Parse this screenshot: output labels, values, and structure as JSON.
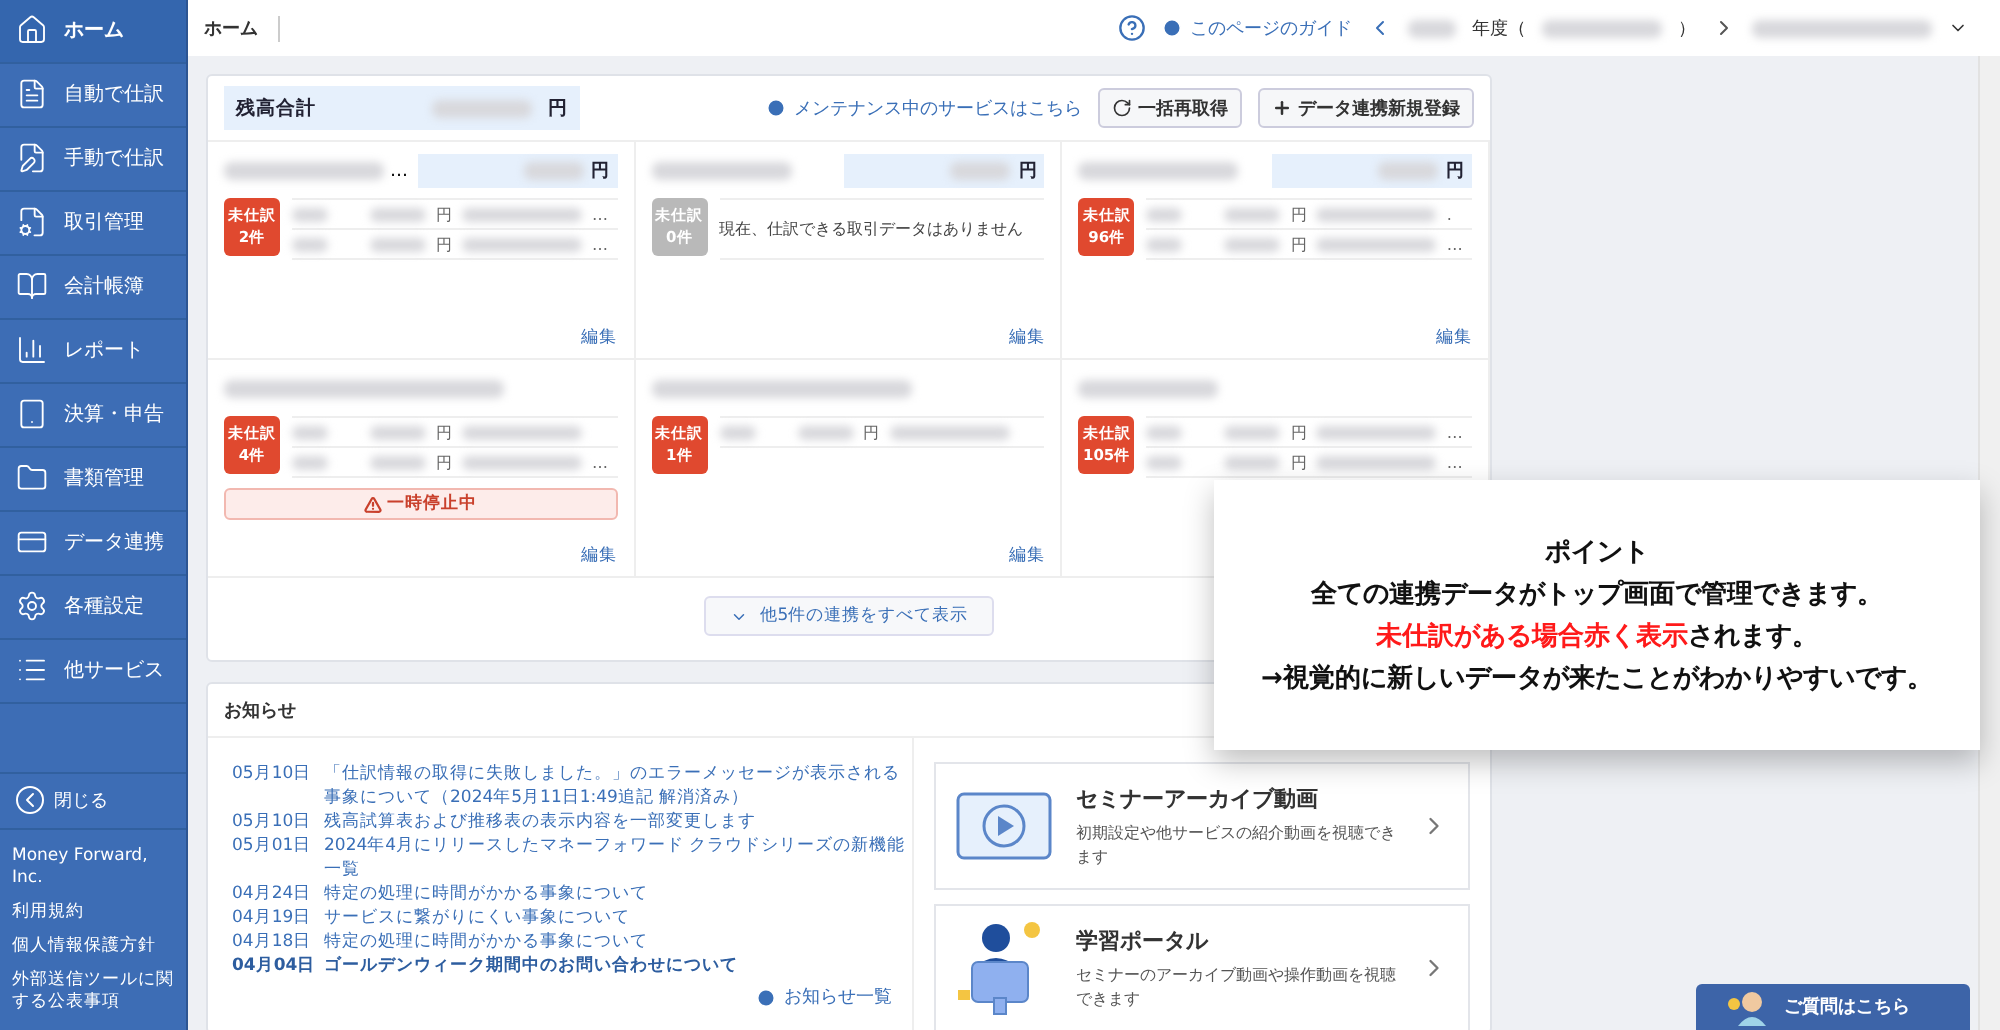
{
  "sidebar": {
    "items": [
      {
        "label": "ホーム",
        "selected": true
      },
      {
        "label": "自動で仕訳",
        "selected": false
      },
      {
        "label": "手動で仕訳",
        "selected": false
      },
      {
        "label": "取引管理",
        "selected": false
      },
      {
        "label": "会計帳簿",
        "selected": false
      },
      {
        "label": "レポート",
        "selected": false
      },
      {
        "label": "決算・申告",
        "selected": false
      },
      {
        "label": "書類管理",
        "selected": false
      },
      {
        "label": "データ連携",
        "selected": false
      },
      {
        "label": "各種設定",
        "selected": false
      },
      {
        "label": "他サービス",
        "selected": false
      }
    ],
    "close": "閉じる",
    "company": "Money Forward, Inc.",
    "links": [
      "利用規約",
      "個人情報保護方針",
      "外部送信ツールに関する公表事項"
    ]
  },
  "header": {
    "breadcrumb": "ホーム",
    "guide": "このページのガイド",
    "year_label": "年度（",
    "year_close": "）"
  },
  "balance": {
    "label": "残高合計",
    "unit": "円",
    "maintenance_link": "メンテナンス中のサービスはこちら",
    "buttons": [
      {
        "kind": "refresh",
        "label": "一括再取得"
      },
      {
        "kind": "add",
        "label": "データ連携新規登録"
      }
    ]
  },
  "accounts": [
    {
      "name_tail": "…",
      "unit": "円",
      "badge": {
        "label": "未仕訳",
        "count": "2件",
        "pending": true
      },
      "rows": [
        {
          "unit": "円",
          "tail": "…"
        },
        {
          "unit": "円",
          "tail": "…"
        }
      ],
      "edit": "編集"
    },
    {
      "unit": "円",
      "badge": {
        "label": "未仕訳",
        "count": "0件",
        "pending": false
      },
      "message": "現在、仕訳できる取引データはありません",
      "edit": "編集"
    },
    {
      "unit": "円",
      "badge": {
        "label": "未仕訳",
        "count": "96件",
        "pending": true
      },
      "rows": [
        {
          "unit": "円",
          "tail": "."
        },
        {
          "unit": "円",
          "tail": "…"
        }
      ],
      "edit": "編集"
    },
    {
      "badge": {
        "label": "未仕訳",
        "count": "4件",
        "pending": true
      },
      "rows": [
        {
          "unit": "円"
        },
        {
          "unit": "円",
          "tail": "…"
        }
      ],
      "warning": "一時停止中",
      "edit": "編集"
    },
    {
      "badge": {
        "label": "未仕訳",
        "count": "1件",
        "pending": true
      },
      "rows": [
        {
          "unit": "円"
        }
      ],
      "edit": "編集"
    },
    {
      "badge": {
        "label": "未仕訳",
        "count": "105件",
        "pending": true
      },
      "rows": [
        {
          "unit": "円",
          "tail": "…"
        },
        {
          "unit": "円",
          "tail": "…"
        }
      ]
    }
  ],
  "show_more": "他5件の連携をすべて表示",
  "news": {
    "title": "お知らせ",
    "items": [
      {
        "date": "05月10日",
        "text": "「仕訳情報の取得に失敗しました。」のエラーメッセージが表示される事象について（2024年5月11日1:49追記 解消済み）",
        "bold": false
      },
      {
        "date": "05月10日",
        "text": "残高試算表および推移表の表示内容を一部変更します",
        "bold": false
      },
      {
        "date": "05月01日",
        "text": "2024年4月にリリースしたマネーフォワード クラウドシリーズの新機能一覧",
        "bold": false
      },
      {
        "date": "04月24日",
        "text": "特定の処理に時間がかかる事象について",
        "bold": false
      },
      {
        "date": "04月19日",
        "text": "サービスに繋がりにくい事象について",
        "bold": false
      },
      {
        "date": "04月18日",
        "text": "特定の処理に時間がかかる事象について",
        "bold": false
      },
      {
        "date": "04月04日",
        "text": "ゴールデンウィーク期間中のお問い合わせについて",
        "bold": true
      }
    ],
    "more_link": "お知らせ一覧"
  },
  "promos": [
    {
      "kind": "video",
      "title": "セミナーアーカイブ動画",
      "description": "初期設定や他サービスの紹介動画を視聴できます"
    },
    {
      "kind": "portal",
      "title": "学習ポータル",
      "description": "セミナーのアーカイブ動画や操作動画を視聴できます"
    }
  ],
  "callout": {
    "title": "ポイント",
    "lines": [
      [
        {
          "text": "全ての連携データがトップ画面で管理できます。",
          "highlight": false
        }
      ],
      [
        {
          "text": "未仕訳がある場合赤く表示",
          "highlight": true
        },
        {
          "text": "されます。",
          "highlight": false
        }
      ],
      [
        {
          "text": "→視覚的に新しいデータが来たことがわかりやすいです。",
          "highlight": false
        }
      ]
    ]
  },
  "help_button": "ご質問はこちら"
}
